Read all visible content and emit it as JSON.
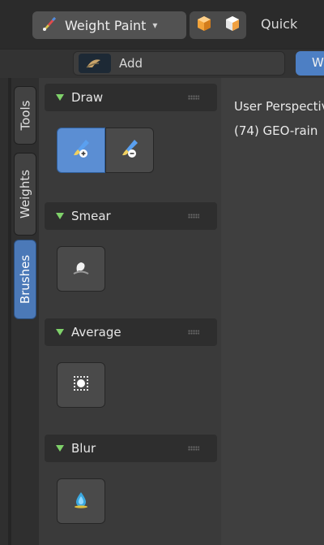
{
  "header": {
    "mode_select_label": "Weight Paint",
    "quick_label": "Quick"
  },
  "subheader": {
    "add_label": "Add",
    "edge_button_label": "W"
  },
  "tabs": [
    {
      "label": "Tools",
      "active": false
    },
    {
      "label": "Weights",
      "active": false
    },
    {
      "label": "Brushes",
      "active": true
    }
  ],
  "sections": [
    {
      "label": "Draw",
      "tools": [
        "brush-add-icon",
        "brush-subtract-icon"
      ]
    },
    {
      "label": "Smear",
      "tools": [
        "smear-icon"
      ]
    },
    {
      "label": "Average",
      "tools": [
        "average-icon"
      ]
    },
    {
      "label": "Blur",
      "tools": [
        "blur-icon"
      ]
    }
  ],
  "viewport": {
    "title": "User Perspective",
    "object": "(74) GEO-rain"
  },
  "colors": {
    "accent": "#5b8ed3",
    "section_triangle": "#7fd26a",
    "active_tab": "#4b79b8"
  }
}
